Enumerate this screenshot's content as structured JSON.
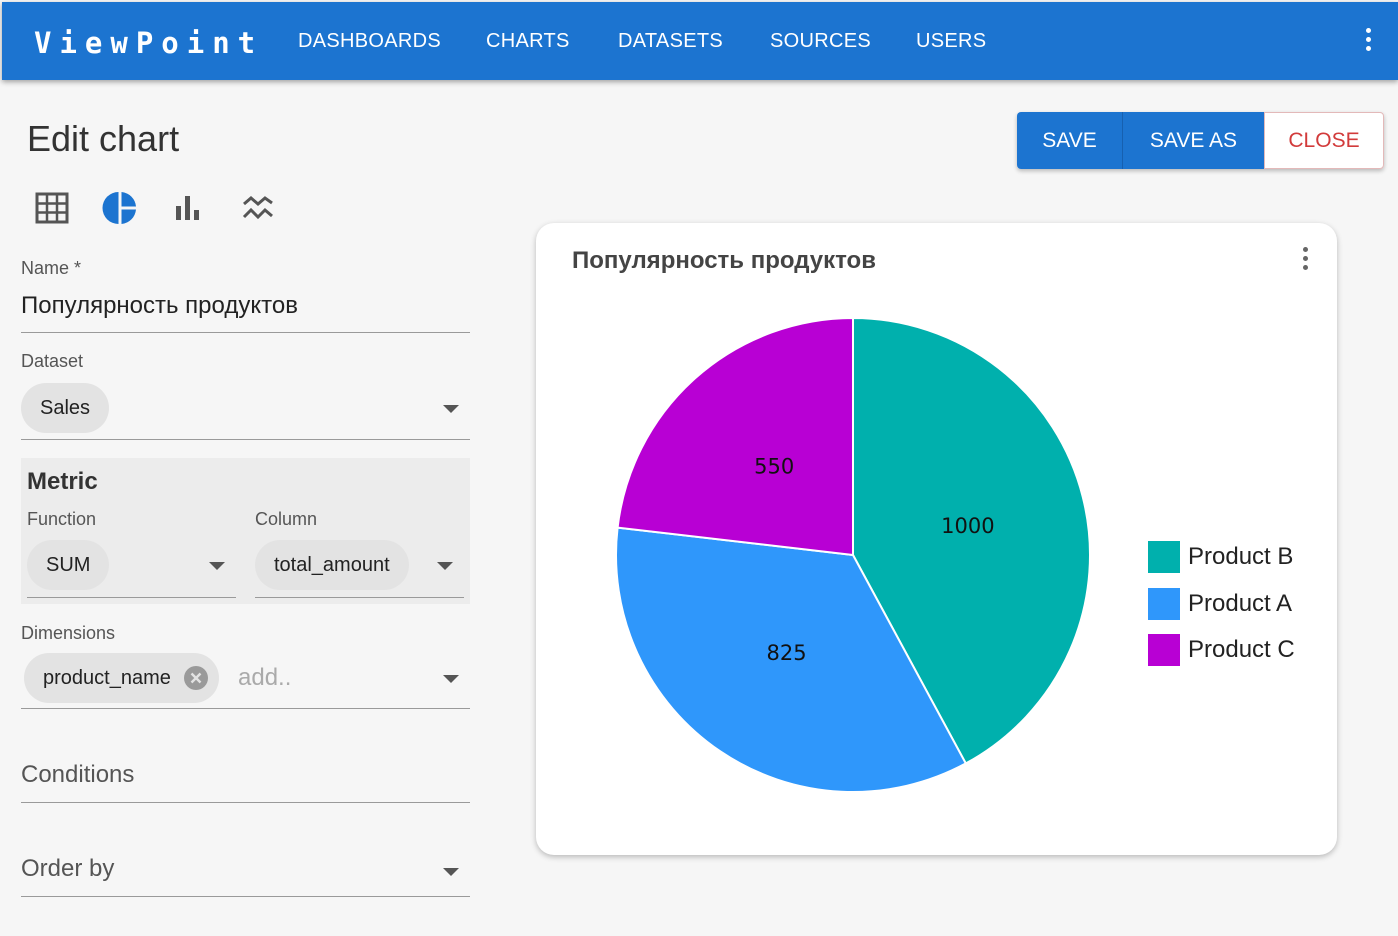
{
  "app": {
    "logo": "ViewPoint",
    "nav": [
      "DASHBOARDS",
      "CHARTS",
      "DATASETS",
      "SOURCES",
      "USERS"
    ]
  },
  "page": {
    "title": "Edit chart",
    "actions": {
      "save": "SAVE",
      "save_as": "SAVE AS",
      "close": "CLOSE"
    }
  },
  "chart_types": [
    "table-icon",
    "pie-chart-icon",
    "bar-chart-icon",
    "line-chart-icon"
  ],
  "form": {
    "name_label": "Name",
    "required_mark": "*",
    "name_value": "Популярность продуктов",
    "dataset_label": "Dataset",
    "dataset_value": "Sales",
    "metric": {
      "title": "Metric",
      "function_label": "Function",
      "function_value": "SUM",
      "column_label": "Column",
      "column_value": "total_amount"
    },
    "dimensions_label": "Dimensions",
    "dimensions_values": [
      "product_name"
    ],
    "dimensions_placeholder": "add..",
    "conditions_label": "Conditions",
    "order_by_label": "Order by"
  },
  "colors": {
    "primary": "#1c74d0",
    "close": "#d23b3b",
    "active_icon": "#1c74d0"
  },
  "chart_data": {
    "type": "pie",
    "title": "Популярность продуктов",
    "categories": [
      "Product B",
      "Product A",
      "Product C"
    ],
    "values": [
      1000,
      825,
      550
    ],
    "colors": [
      "#00b0ad",
      "#2f97fb",
      "#b800d4"
    ],
    "legend_position": "right"
  }
}
